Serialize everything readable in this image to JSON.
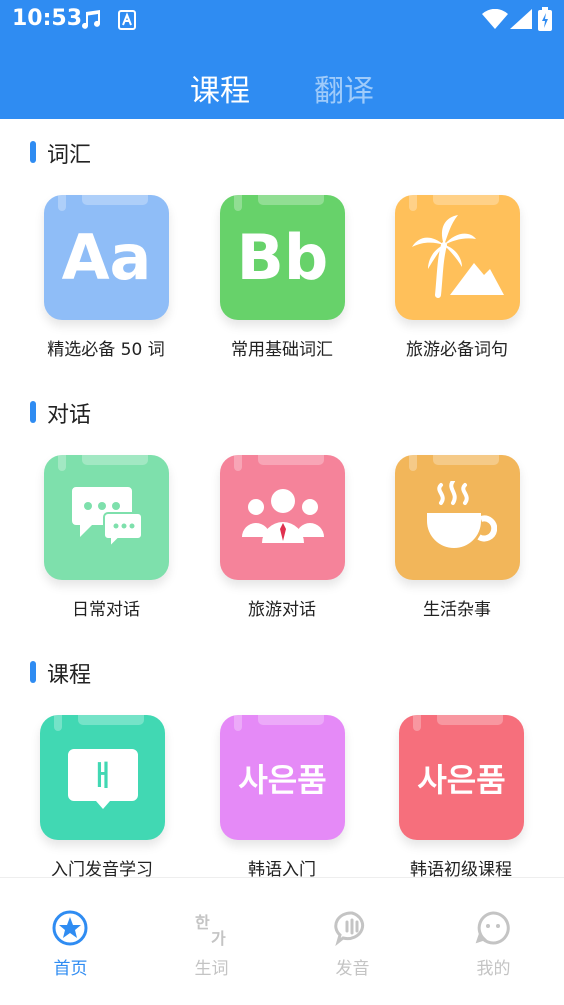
{
  "status_bar": {
    "time": "10:53"
  },
  "header": {
    "tabs": [
      {
        "label": "课程",
        "active": true
      },
      {
        "label": "翻译",
        "active": false
      }
    ]
  },
  "sections": [
    {
      "title": "词汇",
      "items": [
        {
          "label": "精选必备 50 词",
          "glyph": "Aa",
          "icon": "letters-aa-icon",
          "color": "#8fbdf7"
        },
        {
          "label": "常用基础词汇",
          "glyph": "Bb",
          "icon": "letters-bb-icon",
          "color": "#67d26a"
        },
        {
          "label": "旅游必备词句",
          "glyph": "",
          "icon": "palm-tree-icon",
          "color": "#ffc05a"
        }
      ]
    },
    {
      "title": "对话",
      "items": [
        {
          "label": "日常对话",
          "glyph": "",
          "icon": "chat-bubbles-icon",
          "color": "#7ee0ac"
        },
        {
          "label": "旅游对话",
          "glyph": "",
          "icon": "group-people-icon",
          "color": "#f5839a"
        },
        {
          "label": "生活杂事",
          "glyph": "",
          "icon": "coffee-cup-icon",
          "color": "#f2b65a"
        }
      ]
    },
    {
      "title": "课程",
      "items": [
        {
          "label": "入门发音学习",
          "glyph": "ㅐ",
          "icon": "hangul-speech-icon",
          "color": "#41d8b3"
        },
        {
          "label": "韩语入门",
          "glyph": "사은품",
          "icon": "hangul-text-icon",
          "color": "#e58af7"
        },
        {
          "label": "韩语初级课程",
          "glyph": "사은품",
          "icon": "hangul-text-icon",
          "color": "#f66f7c"
        }
      ]
    }
  ],
  "bottom_nav": [
    {
      "label": "首页",
      "icon": "star-icon",
      "active": true
    },
    {
      "label": "生词",
      "icon": "hangul-book-icon",
      "active": false
    },
    {
      "label": "发音",
      "icon": "speech-icon",
      "active": false
    },
    {
      "label": "我的",
      "icon": "smile-icon",
      "active": false
    }
  ],
  "colors": {
    "primary": "#2f8cf2",
    "inactive_nav": "#c4c4c4"
  }
}
